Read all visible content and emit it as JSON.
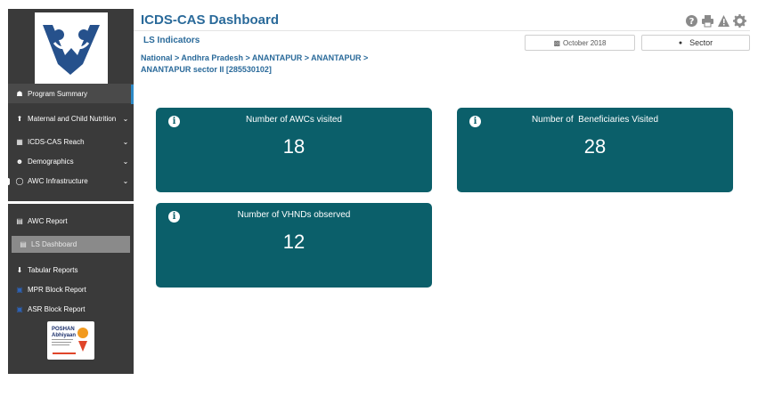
{
  "app": {
    "title": "ICDS-CAS Dashboard"
  },
  "header": {
    "subtitle": "LS Indicators",
    "breadcrumb": "National > Andhra Pradesh > ANANTAPUR > ANANTAPUR > ANANTAPUR sector II [285530102]",
    "date_filter": "October 2018",
    "sector_filter": "Sector",
    "icons": [
      "help-icon",
      "print-icon",
      "warning-icon",
      "gear-icon"
    ]
  },
  "sidebar": {
    "items": [
      {
        "label": "Program Summary",
        "icon": "home-icon",
        "chevron": ""
      },
      {
        "label": "Maternal and Child Nutrition",
        "icon": "pin-icon",
        "chevron": "⌄"
      },
      {
        "label": "ICDS-CAS Reach",
        "icon": "bar-chart-icon",
        "chevron": "⌄"
      },
      {
        "label": "Demographics",
        "icon": "users-icon",
        "chevron": "⌄"
      },
      {
        "label": "AWC Infrastructure",
        "icon": "bulb-icon",
        "chevron": "⌄"
      }
    ],
    "reports": [
      {
        "label": "AWC Report",
        "icon": "report-icon"
      },
      {
        "label": "LS Dashboard",
        "icon": "dashboard-icon"
      },
      {
        "label": "Tabular Reports",
        "icon": "download-icon"
      },
      {
        "label": "MPR Block Report",
        "icon": "block-report-icon"
      },
      {
        "label": "ASR Block Report",
        "icon": "block-report-icon"
      }
    ],
    "poshan_logo": {
      "line1": "POSHAN",
      "line2": "Abhiyaan"
    }
  },
  "cards": [
    {
      "title": "Number of AWCs visited",
      "value": "18"
    },
    {
      "title": "Number of  Beneficiaries Visited",
      "value": "28"
    },
    {
      "title": "Number of VHNDs observed",
      "value": "12"
    }
  ],
  "colors": {
    "card": "#0b5f6a",
    "title": "#2a6a9a",
    "sidebar": "#3a3a3a",
    "accent": "#2c89c6"
  }
}
